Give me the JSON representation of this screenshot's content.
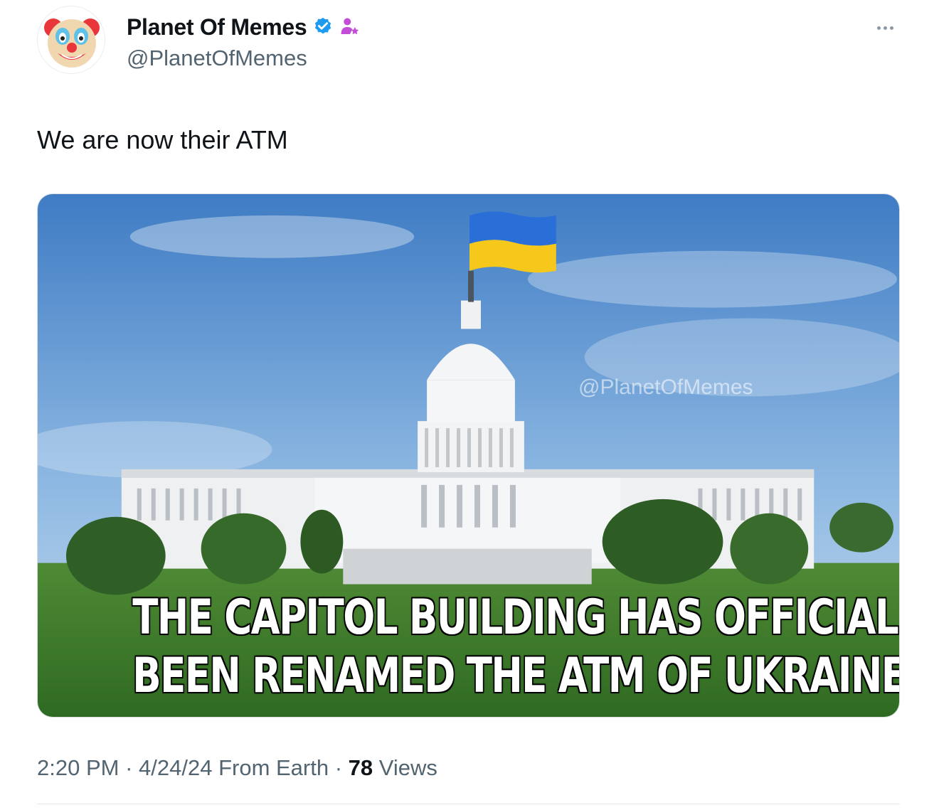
{
  "author": {
    "display_name": "Planet Of Memes",
    "handle": "@PlanetOfMemes",
    "avatar_icon": "clown-face-icon",
    "verified_icon": "verified-badge-icon",
    "affiliate_icon": "person-star-icon",
    "verified_color": "#1d9bf0",
    "affiliate_color": "#c44dd8"
  },
  "more_icon": "more-options-icon",
  "tweet": {
    "text": "We are now their ATM"
  },
  "media": {
    "watermark": "@PlanetOfMemes",
    "caption_line1": "THE CAPITOL BUILDING HAS OFFICIALLY",
    "caption_line2": "BEEN RENAMED THE ATM OF UKRAINE",
    "flag_colors": [
      "#2a6fd8",
      "#f7c81c"
    ]
  },
  "meta": {
    "time": "2:20 PM",
    "sep1": " · ",
    "date": "4/24/24",
    "source": " From Earth",
    "sep2": " · ",
    "views_count": "78",
    "views_label": " Views"
  }
}
